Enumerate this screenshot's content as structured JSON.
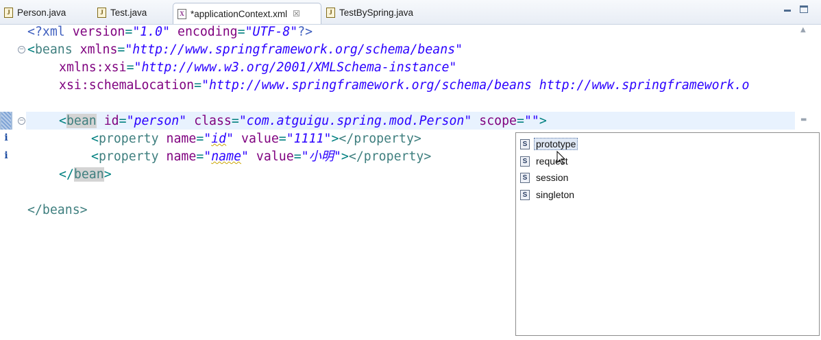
{
  "tabs": [
    {
      "label": "Person.java",
      "icon": "java-file-icon"
    },
    {
      "label": "Test.java",
      "icon": "java-file-icon"
    },
    {
      "label": "*applicationContext.xml",
      "icon": "xml-file-icon",
      "active": true,
      "close": "☒"
    },
    {
      "label": "TestBySpring.java",
      "icon": "java-file-icon"
    }
  ],
  "code": {
    "l1": {
      "pi_open": "<?xml ",
      "a1": "version",
      "eq": "=",
      "v1": "\"1.0\"",
      "a2": " encoding",
      "v2": "\"UTF-8\"",
      "pi_close": "?>"
    },
    "l2": {
      "open": "<",
      "tag": "beans",
      "attr": " xmlns",
      "eq": "=",
      "val": "\"http://www.springframework.org/schema/beans\""
    },
    "l3": {
      "attr": "xmlns:xsi",
      "eq": "=",
      "val": "\"http://www.w3.org/2001/XMLSchema-instance\""
    },
    "l4": {
      "attr": "xsi:schemaLocation",
      "eq": "=",
      "val": "\"http://www.springframework.org/schema/beans http://www.springframework.o"
    },
    "l5": {
      "open": "<",
      "tag": "bean",
      "a1": " id",
      "v1": "\"person\"",
      "a2": " class",
      "v2": "\"com.atguigu.spring.mod.Person\"",
      "a3": " scope",
      "v3": "\"\"",
      "close": ">"
    },
    "l6": {
      "open": "<",
      "tag": "property",
      "a1": " name",
      "v1a": "\"",
      "v1b": "id",
      "v1c": "\"",
      "a2": " value",
      "v2": "\"1111\"",
      "close": ">",
      "end": "</property>"
    },
    "l7": {
      "open": "<",
      "tag": "property",
      "a1": " name",
      "v1a": "\"",
      "v1b": "name",
      "v1c": "\"",
      "a2": " value",
      "v2": "\"小明\"",
      "close": ">",
      "end": "</property>"
    },
    "l8": {
      "open": "</",
      "tag": "bean",
      "close": ">"
    },
    "l9": {
      "text": "</beans>"
    },
    "eq": "="
  },
  "assist": {
    "items": [
      {
        "label": "prototype",
        "icon": "S",
        "selected": true
      },
      {
        "label": "request",
        "icon": "S"
      },
      {
        "label": "session",
        "icon": "S"
      },
      {
        "label": "singleton",
        "icon": "S"
      }
    ]
  },
  "markers": {
    "info": "i",
    "fold": "−"
  },
  "colors": {
    "tag": "#3f7f7f",
    "attr": "#7f007f",
    "string": "#2a00ff",
    "current_line": "#e8f2fe"
  }
}
